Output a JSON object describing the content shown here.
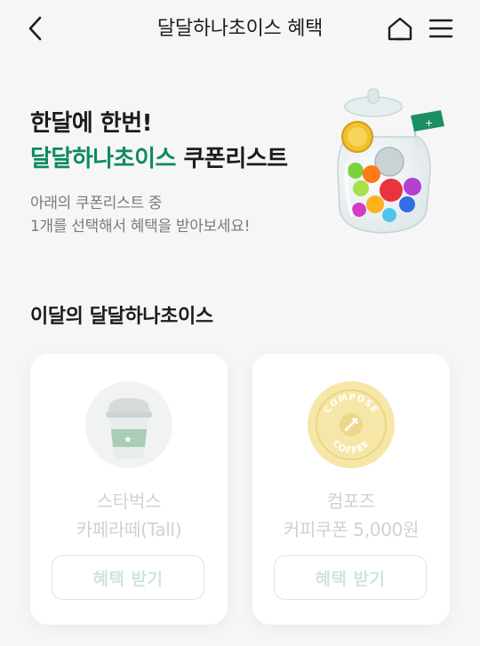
{
  "header": {
    "title": "달달하나초이스 혜택",
    "back_icon": "chevron-left-icon",
    "home_icon": "home-icon",
    "menu_icon": "hamburger-menu-icon"
  },
  "hero": {
    "line1": "한달에 한번!",
    "line2_brand": "달달하나초이스",
    "line2_rest": " 쿠폰리스트",
    "desc_line1": "아래의 쿠폰리스트 중",
    "desc_line2": "1개를 선택해서 혜택을 받아보세요!",
    "illustration": "coupon-jar-illustration"
  },
  "section": {
    "title": "이달의 달달하나초이스"
  },
  "coupons": [
    {
      "brand": "스타벅스",
      "item": "카페라떼(Tall)",
      "button": "혜택 받기",
      "logo": "starbucks-cup-icon"
    },
    {
      "brand": "컴포즈",
      "item": "커피쿠폰 5,000원",
      "button": "혜택 받기",
      "logo": "compose-coffee-logo",
      "logo_text": "COMPOSE COFFEE"
    }
  ],
  "colors": {
    "brand_green": "#0e8a5f",
    "disabled_text": "#cfd2d5",
    "button_border": "#d7eae4",
    "compose_yellow": "#f6e7a8"
  }
}
